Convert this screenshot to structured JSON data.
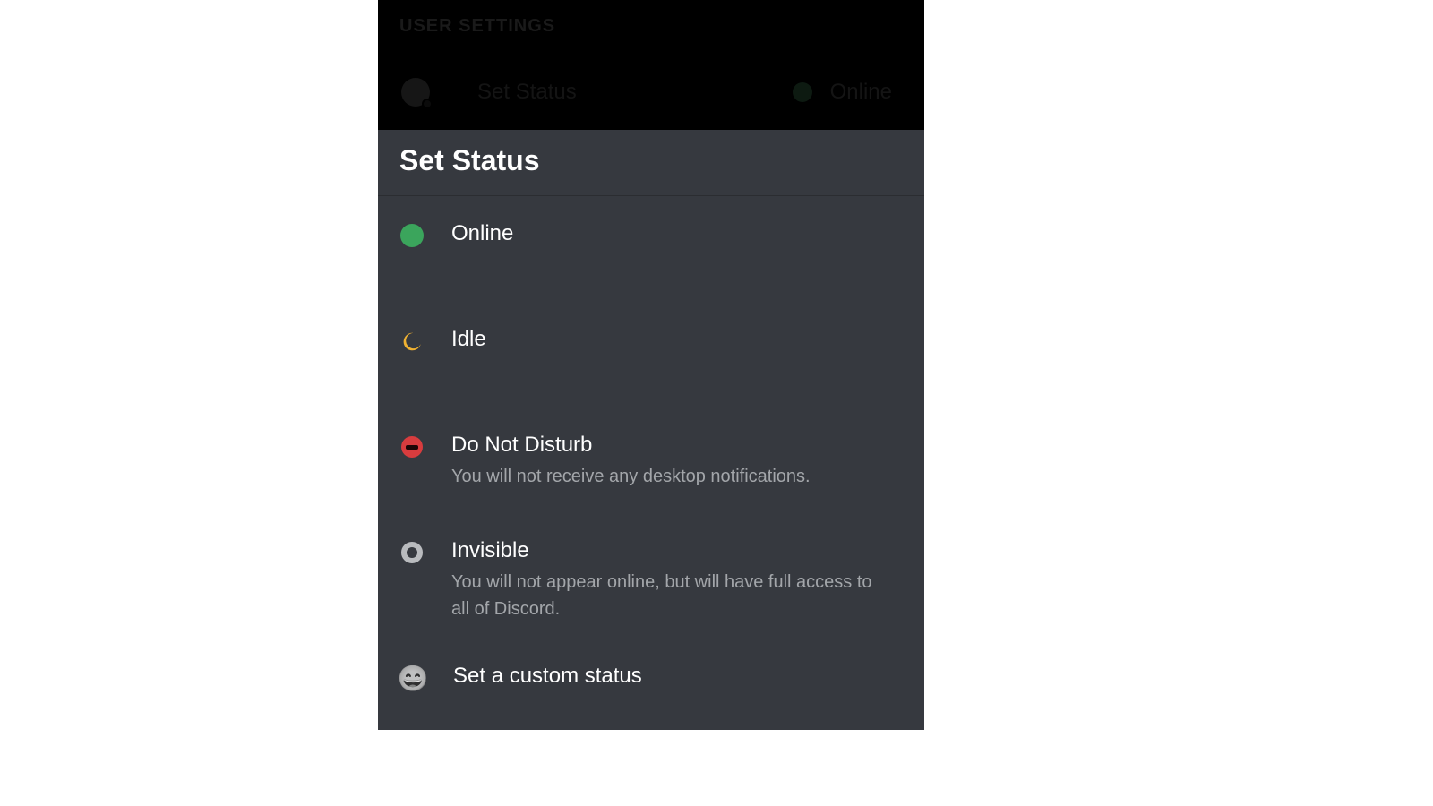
{
  "header": {
    "section_label": "USER SETTINGS",
    "row_label": "Set Status",
    "current_status_label": "Online"
  },
  "sheet": {
    "title": "Set Status",
    "options": {
      "online": {
        "label": "Online"
      },
      "idle": {
        "label": "Idle"
      },
      "dnd": {
        "label": "Do Not Disturb",
        "desc": "You will not receive any desktop notifications."
      },
      "invisible": {
        "label": "Invisible",
        "desc": "You will not appear online, but will have full access to all of Discord."
      },
      "custom": {
        "label": "Set a custom status"
      }
    }
  },
  "icons": {
    "online": "online-dot-icon",
    "idle": "idle-moon-icon",
    "dnd": "dnd-icon",
    "invisible": "invisible-ring-icon",
    "custom": "emoji-smile-icon"
  },
  "colors": {
    "online": "#3ba55c",
    "idle": "#f0b232",
    "dnd": "#d83c3e",
    "bg": "#36393f"
  }
}
